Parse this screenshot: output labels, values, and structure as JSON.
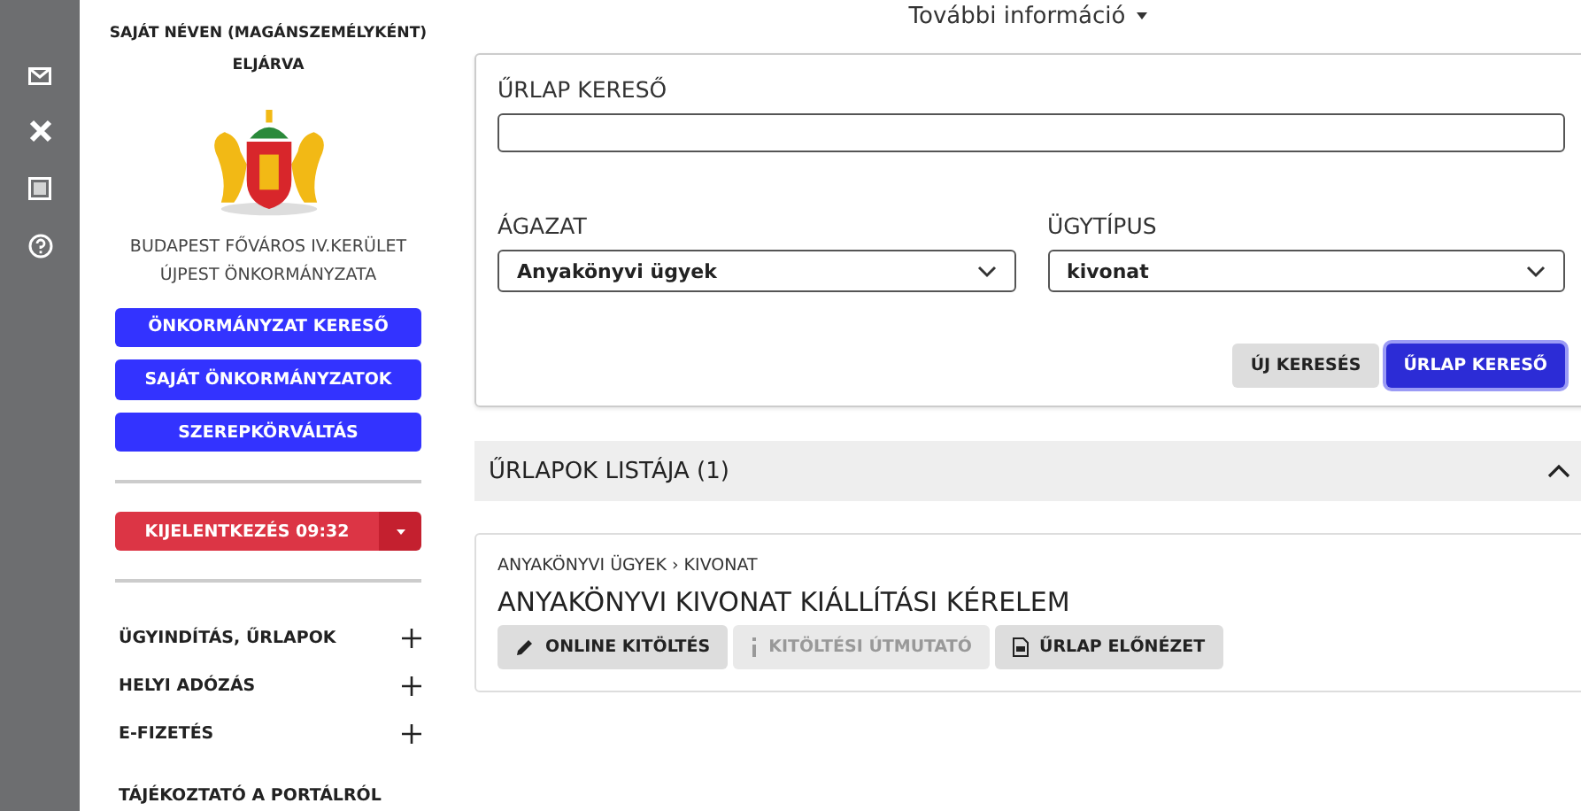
{
  "sidebar": {
    "identity": "SAJÁT NÉVEN (MAGÁNSZEMÉLYKÉNT) ELJÁRVA",
    "municipality": [
      "BUDAPEST FŐVÁROS IV.KERÜLET",
      "ÚJPEST ÖNKORMÁNYZATA"
    ],
    "buttons": [
      "ÖNKORMÁNYZAT KERESŐ",
      "SAJÁT ÖNKORMÁNYZATOK",
      "SZEREPKÖRVÁLTÁS"
    ],
    "logout": "KIJELENTKEZÉS 09:32",
    "menu": [
      {
        "label": "ÜGYINDÍTÁS, ŰRLAPOK",
        "expandable": true
      },
      {
        "label": "HELYI ADÓZÁS",
        "expandable": true
      },
      {
        "label": "E-FIZETÉS",
        "expandable": true
      },
      {
        "label": "TÁJÉKOZTATÓ A PORTÁLRÓL",
        "expandable": false
      }
    ]
  },
  "more_info": "További információ",
  "search": {
    "title": "ŰRLAP KERESŐ",
    "sector": {
      "label": "ÁGAZAT",
      "value": "Anyakönyvi ügyek"
    },
    "case_type": {
      "label": "ÜGYTÍPUS",
      "value": "kivonat"
    },
    "buttons": [
      {
        "label": "ÚJ KERESÉS",
        "kind": "secondary"
      },
      {
        "label": "ŰRLAP KERESŐ",
        "kind": "primary"
      }
    ]
  },
  "forms_list": {
    "title": "ŰRLAPOK LISTÁJA (1)",
    "expanded": true,
    "items": [
      {
        "breadcrumb": "ANYAKÖNYVI ÜGYEK › KIVONAT",
        "title": "ANYAKÖNYVI KIVONAT KIÁLLÍTÁSI KÉRELEM",
        "actions": [
          {
            "label": "ONLINE KITÖLTÉS",
            "kind": "pencil",
            "disabled": false
          },
          {
            "label": "KITÖLTÉSI ÚTMUTATÓ",
            "kind": "info",
            "disabled": true
          },
          {
            "label": "ŰRLAP ELŐNÉZET",
            "kind": "document",
            "disabled": false
          }
        ]
      }
    ]
  }
}
